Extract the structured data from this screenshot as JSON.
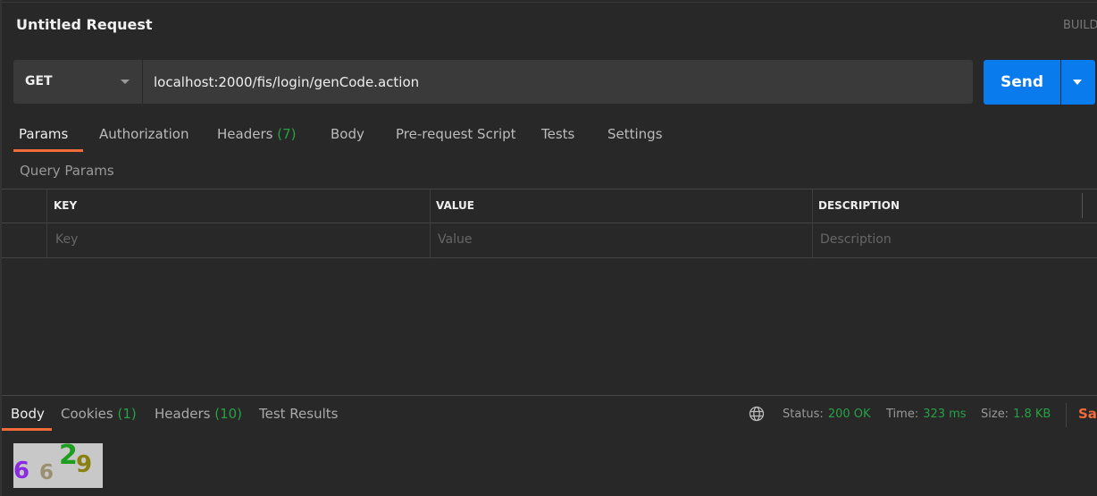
{
  "request": {
    "title": "Untitled Request",
    "build_label": "BUILD",
    "method": "GET",
    "url": "localhost:2000/fis/login/genCode.action",
    "send_label": "Send"
  },
  "tabs": [
    {
      "label": "Params"
    },
    {
      "label": "Authorization"
    },
    {
      "label": "Headers",
      "count": "(7)"
    },
    {
      "label": "Body"
    },
    {
      "label": "Pre-request Script"
    },
    {
      "label": "Tests"
    },
    {
      "label": "Settings"
    }
  ],
  "params": {
    "section_label": "Query Params",
    "columns": [
      "KEY",
      "VALUE",
      "DESCRIPTION"
    ],
    "placeholders": [
      "Key",
      "Value",
      "Description"
    ]
  },
  "response": {
    "tabs": [
      {
        "label": "Body"
      },
      {
        "label": "Cookies",
        "count": "(1)"
      },
      {
        "label": "Headers",
        "count": "(10)"
      },
      {
        "label": "Test Results"
      }
    ],
    "status_label": "Status:",
    "status": "200 OK",
    "time_label": "Time:",
    "time": "323 ms",
    "size_label": "Size:",
    "size": "1.8 KB",
    "save_label": "Save",
    "captcha": {
      "chars": [
        "6",
        "6",
        "2",
        "9"
      ],
      "colors": [
        "#8a2be2",
        "#9a9070",
        "#1e9e1e",
        "#8a8010"
      ]
    }
  },
  "colors": {
    "accent": "#f26b3a",
    "primary": "#097bed",
    "success": "#26a144",
    "background": "#282828"
  }
}
